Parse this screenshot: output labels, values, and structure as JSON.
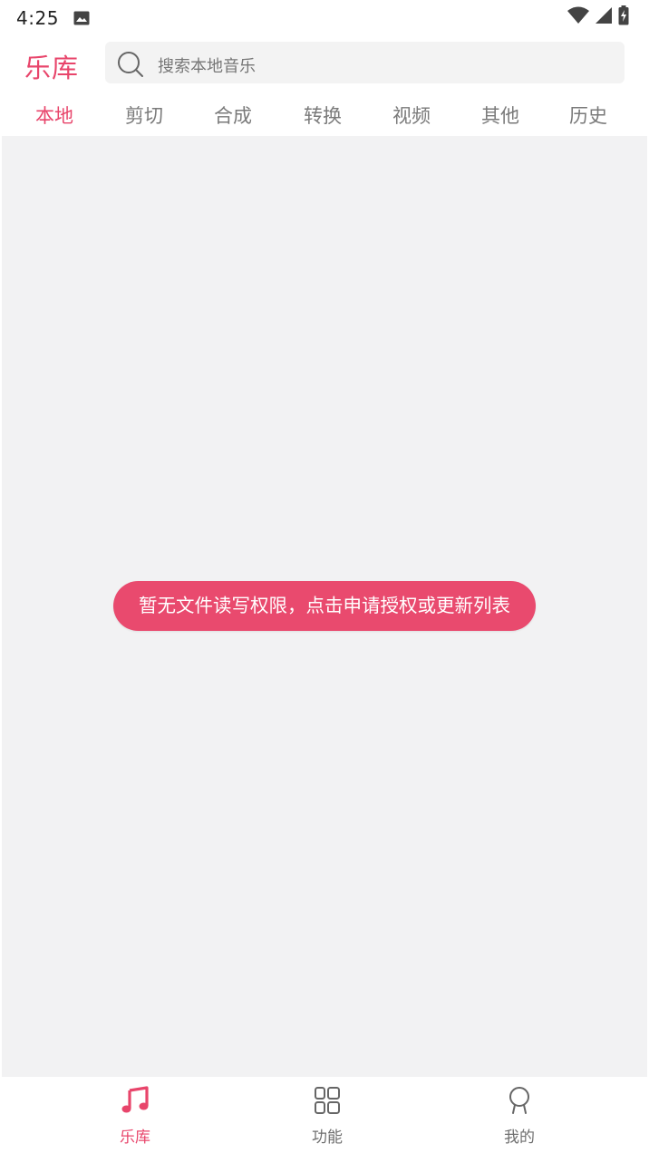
{
  "status_bar": {
    "time": "4:25",
    "icons": [
      "image-icon",
      "wifi-icon",
      "signal-icon",
      "battery-charging-icon"
    ]
  },
  "header": {
    "title": "乐库",
    "search": {
      "placeholder": "搜索本地音乐",
      "icon": "search-icon"
    }
  },
  "tabs": [
    {
      "label": "本地",
      "active": true
    },
    {
      "label": "剪切",
      "active": false
    },
    {
      "label": "合成",
      "active": false
    },
    {
      "label": "转换",
      "active": false
    },
    {
      "label": "视频",
      "active": false
    },
    {
      "label": "其他",
      "active": false
    },
    {
      "label": "历史",
      "active": false
    }
  ],
  "content": {
    "notice": "暂无文件读写权限，点击申请授权或更新列表"
  },
  "bottom_nav": [
    {
      "label": "乐库",
      "icon": "music-note-icon",
      "active": true
    },
    {
      "label": "功能",
      "icon": "grid-icon",
      "active": false
    },
    {
      "label": "我的",
      "icon": "profile-icon",
      "active": false
    }
  ],
  "colors": {
    "accent": "#e8456b",
    "content_bg": "#f2f2f3",
    "inactive_text": "#7a7a7a"
  }
}
